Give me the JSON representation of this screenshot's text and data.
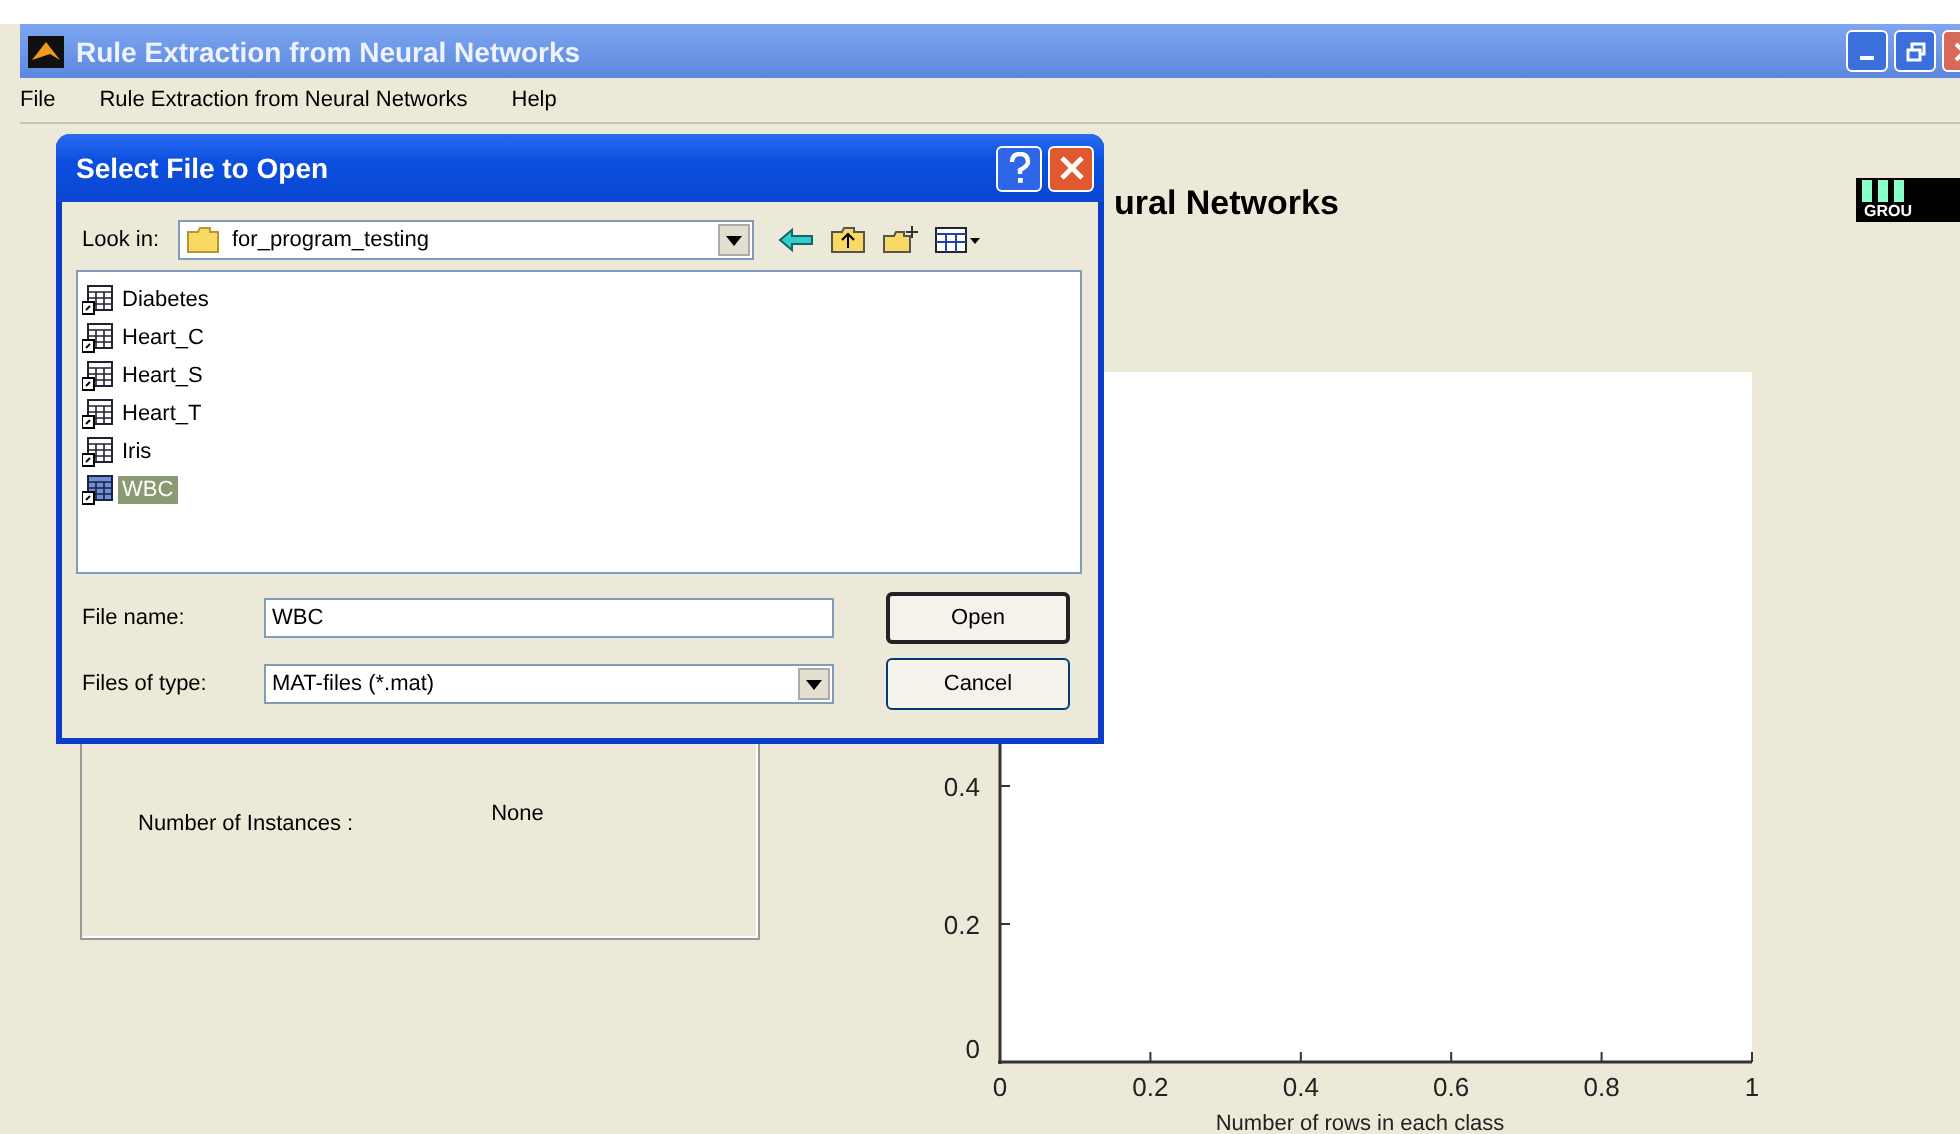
{
  "window": {
    "title": "Rule Extraction from Neural Networks"
  },
  "menu": [
    "File",
    "Rule Extraction from Neural Networks",
    "Help"
  ],
  "logo": {
    "text": "GROU"
  },
  "info_panel": {
    "label": "Number of Instances :",
    "value": "None"
  },
  "chart_data": {
    "type": "line",
    "title": "ural Networks",
    "xlabel": "Number of rows in each class",
    "xlim": [
      0,
      1
    ],
    "ylim": [
      0,
      1
    ],
    "xticks": [
      0,
      0.2,
      0.4,
      0.6,
      0.8,
      1
    ],
    "yticks": [
      0,
      0.2,
      0.4
    ]
  },
  "dialog": {
    "title": "Select File to Open",
    "look_in_label": "Look in:",
    "look_in": "for_program_testing",
    "files": [
      {
        "name": "Diabetes",
        "selected": false
      },
      {
        "name": "Heart_C",
        "selected": false
      },
      {
        "name": "Heart_S",
        "selected": false
      },
      {
        "name": "Heart_T",
        "selected": false
      },
      {
        "name": "Iris",
        "selected": false
      },
      {
        "name": "WBC",
        "selected": true
      }
    ],
    "file_name_label": "File name:",
    "file_name": "WBC",
    "file_type_label": "Files of type:",
    "file_type": "MAT-files (*.mat)",
    "buttons": [
      "Open",
      "Cancel"
    ]
  }
}
